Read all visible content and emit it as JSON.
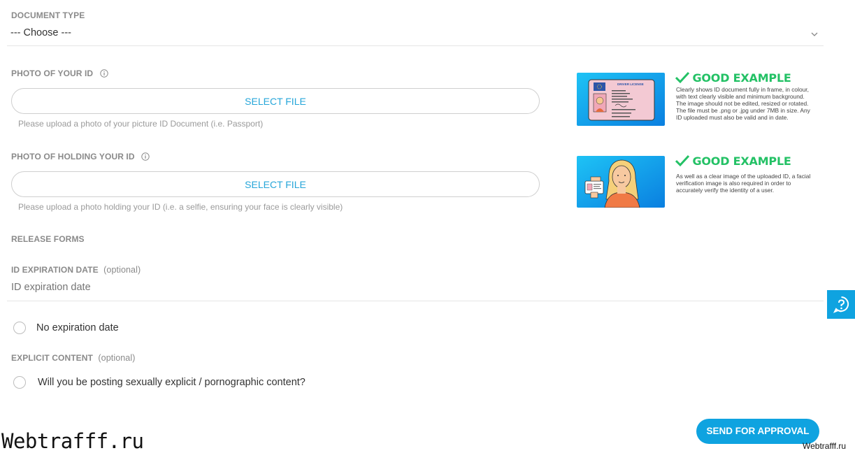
{
  "document_type": {
    "label": "DOCUMENT TYPE",
    "selected": "--- Choose ---"
  },
  "photo_id": {
    "label": "PHOTO OF YOUR ID",
    "button": "SELECT FILE",
    "hint": "Please upload a photo of your picture ID Document (i.e. Passport)"
  },
  "photo_holding": {
    "label": "PHOTO OF HOLDING YOUR ID",
    "button": "SELECT FILE",
    "hint": "Please upload a photo holding your ID (i.e. a selfie, ensuring your face is clearly visible)"
  },
  "example1": {
    "title": "GOOD EXAMPLE",
    "text": "Clearly shows ID document fully in frame, in colour, with text clearly visible and minimum background. The image should not be edited, resized or rotated. The file must be .png or .jpg under 7MB in size. Any ID uploaded must also be valid and in date.",
    "card_title": "DRIVER LICENSE"
  },
  "example2": {
    "title": "GOOD EXAMPLE",
    "text": "As well as a clear image of the uploaded ID, a facial verification image is also required in order to accurately verify the identity of a user."
  },
  "release_forms": {
    "label": "RELEASE FORMS"
  },
  "expiration": {
    "label": "ID EXPIRATION DATE",
    "optional": "(optional)",
    "placeholder": "ID expiration date",
    "no_expiration": "No expiration date"
  },
  "explicit": {
    "label": "EXPLICIT CONTENT",
    "optional": "(optional)",
    "question": "Will you be posting sexually explicit / pornographic content?"
  },
  "submit": {
    "label": "SEND FOR APPROVAL"
  },
  "watermark": {
    "big": "Webtrafff.ru",
    "small": "Webtrafff.ru"
  },
  "colors": {
    "accent": "#0fa3e0",
    "good": "#23c165",
    "link": "#26a6d9"
  },
  "icons": {
    "help": "help-question-icon",
    "info": "info-icon",
    "chevron": "chevron-down-icon",
    "check": "checkmark-icon"
  }
}
